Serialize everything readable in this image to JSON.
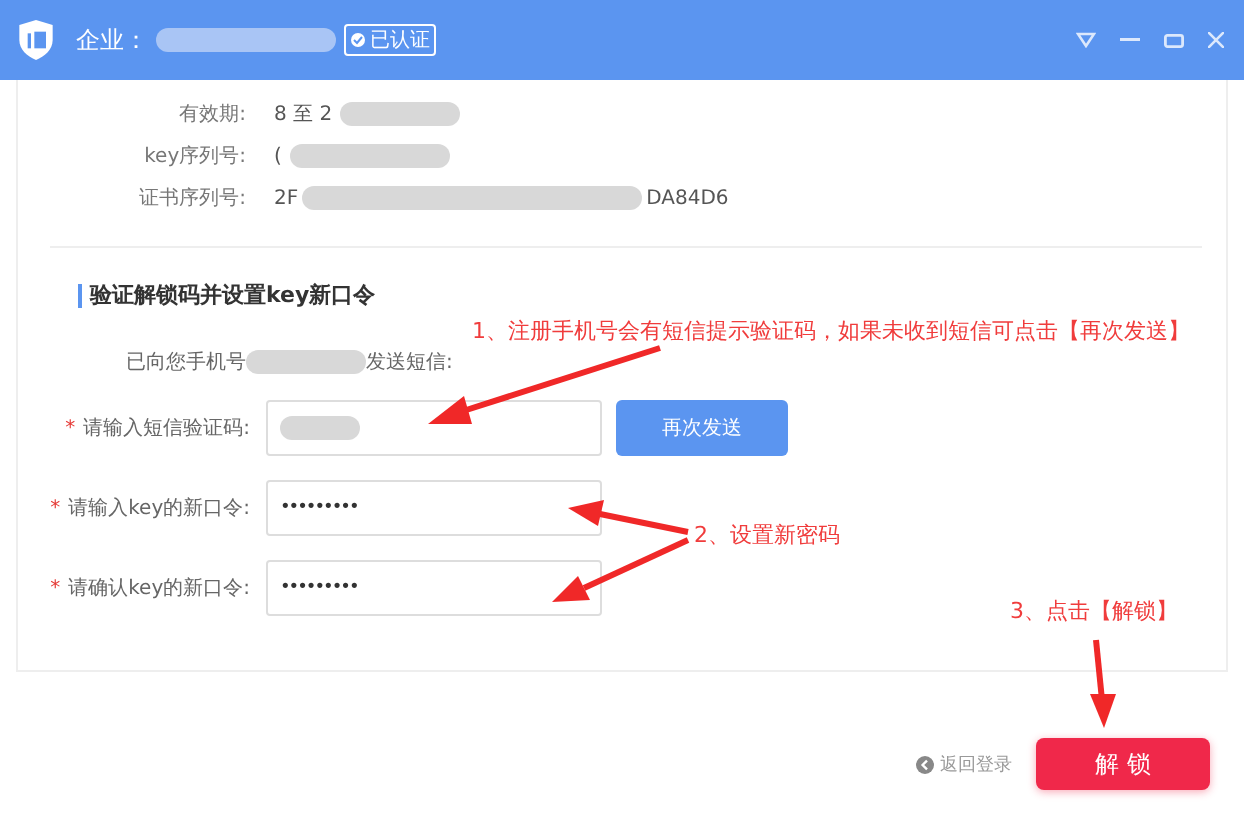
{
  "window": {
    "title": "企业：",
    "badge": "已认证"
  },
  "info": [
    {
      "label": "有效期:",
      "value": "8 至 2"
    },
    {
      "label": "key序列号:",
      "value": "("
    },
    {
      "label": "证书序列号:",
      "value": "2F",
      "value_end": "DA84D6"
    }
  ],
  "section": {
    "title": "验证解锁码并设置key新口令",
    "sms_prefix": "已向您手机号",
    "sms_suffix": "发送短信:"
  },
  "fields": [
    {
      "marker": "*",
      "label": "请输入短信验证码:",
      "kind": "code"
    },
    {
      "marker": "*",
      "label": "请输入key的新口令:",
      "kind": "password",
      "value": "•••••••••"
    },
    {
      "marker": "*",
      "label": "请确认key的新口令:",
      "kind": "password",
      "value": "•••••••••"
    }
  ],
  "resend_button": "再次发送",
  "back_link": "返回登录",
  "unlock_button": "解 锁",
  "annotations": [
    {
      "text": "1、注册手机号会有短信提示验证码，如果未收到短信可点击【再次发送】"
    },
    {
      "text": "2、设置新密码"
    },
    {
      "text": "3、点击【解锁】"
    }
  ]
}
